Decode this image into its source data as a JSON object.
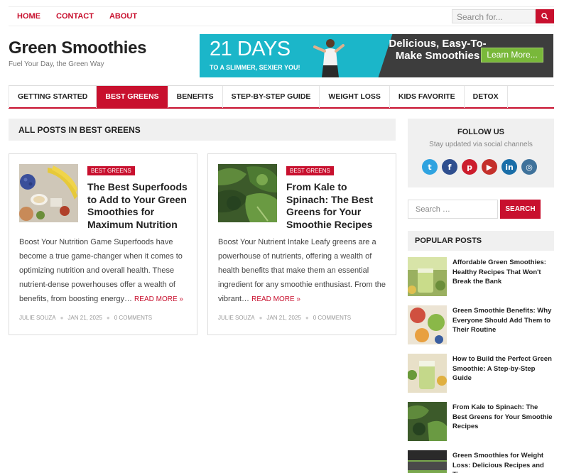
{
  "top_nav": [
    {
      "label": "HOME"
    },
    {
      "label": "CONTACT"
    },
    {
      "label": "ABOUT"
    }
  ],
  "top_search": {
    "placeholder": "Search for..."
  },
  "site": {
    "title": "Green Smoothies",
    "tagline": "Fuel Your Day, the Green Way"
  },
  "banner": {
    "days": "21 DAYS",
    "slim": "TO A SLIMMER, SEXIER YOU!",
    "headline": "Delicious, Easy-To-Make Smoothies",
    "cta": "Learn More..."
  },
  "main_nav": [
    {
      "label": "GETTING STARTED",
      "active": false
    },
    {
      "label": "BEST GREENS",
      "active": true
    },
    {
      "label": "BENEFITS",
      "active": false
    },
    {
      "label": "STEP-BY-STEP GUIDE",
      "active": false
    },
    {
      "label": "WEIGHT LOSS",
      "active": false
    },
    {
      "label": "KIDS FAVORITE",
      "active": false
    },
    {
      "label": "DETOX",
      "active": false
    }
  ],
  "archive_title": "ALL POSTS IN BEST GREENS",
  "posts": [
    {
      "category": "BEST GREENS",
      "title": "The Best Superfoods to Add to Your Green Smoothies for Maximum Nutrition",
      "excerpt": "Boost Your Nutrition Game Superfoods have become a true game-changer when it comes to optimizing nutrition and overall health. These nutrient-dense powerhouses offer a wealth of benefits, from boosting energy…",
      "read_more": "READ MORE »",
      "author": "JULIE SOUZA",
      "date": "JAN 21, 2025",
      "comments": "0 COMMENTS",
      "image": "superfoods-image"
    },
    {
      "category": "BEST GREENS",
      "title": "From Kale to Spinach: The Best Greens for Your Smoothie Recipes",
      "excerpt": "Boost Your Nutrient Intake Leafy greens are a powerhouse of nutrients, offering a wealth of health benefits that make them an essential ingredient for any smoothie enthusiast. From the vibrant…",
      "read_more": "READ MORE »",
      "author": "JULIE SOUZA",
      "date": "JAN 21, 2025",
      "comments": "0 COMMENTS",
      "image": "greens-image"
    }
  ],
  "follow": {
    "heading": "FOLLOW US",
    "subtitle": "Stay updated via social channels",
    "icons": [
      "twitter-icon",
      "facebook-icon",
      "pinterest-icon",
      "youtube-icon",
      "linkedin-icon",
      "instagram-icon"
    ]
  },
  "side_search": {
    "placeholder": "Search …",
    "button": "SEARCH"
  },
  "popular": {
    "heading": "POPULAR POSTS",
    "items": [
      {
        "title": "Affordable Green Smoothies: Healthy Recipes That Won't Break the Bank"
      },
      {
        "title": "Green Smoothie Benefits: Why Everyone Should Add Them to Their Routine"
      },
      {
        "title": "How to Build the Perfect Green Smoothie: A Step-by-Step Guide"
      },
      {
        "title": "From Kale to Spinach: The Best Greens for Your Smoothie Recipes"
      },
      {
        "title": "Green Smoothies for Weight Loss: Delicious Recipes and Tips"
      }
    ]
  },
  "colors": {
    "accent": "#c8102e",
    "banner_teal": "#1bb6c9",
    "cta_green": "#79b83a"
  }
}
